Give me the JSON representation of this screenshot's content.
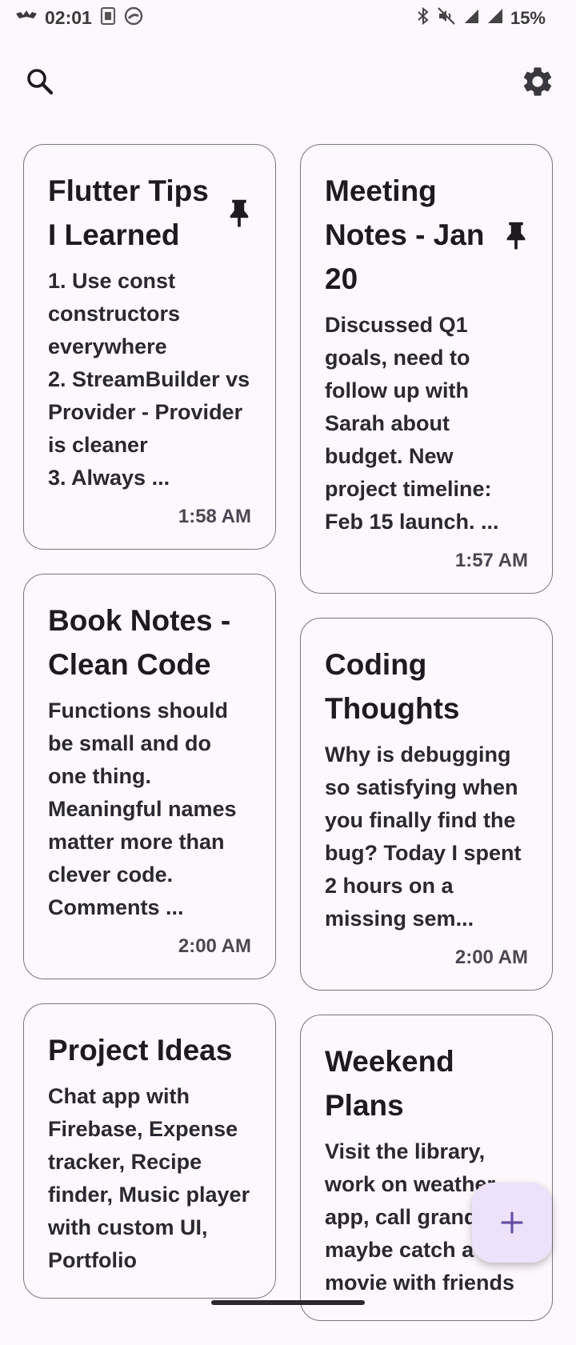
{
  "status_bar": {
    "time": "02:01",
    "battery": "15%",
    "icons": [
      "bat-icon",
      "notification-app-icon",
      "messenger-icon",
      "bluetooth-icon",
      "mute-icon",
      "signal-icon",
      "signal-icon-2"
    ]
  },
  "app_bar": {
    "search_icon": "search-icon",
    "settings_icon": "gear-icon"
  },
  "notes_left": [
    {
      "title": "Flutter Tips I Learned",
      "pinned": true,
      "body": "1. Use const constructors everywhere\n2. StreamBuilder vs Provider - Provider is cleaner\n3. Always ...",
      "time": "1:58 AM"
    },
    {
      "title": "Book Notes - Clean Code",
      "pinned": false,
      "body": "Functions should be small and do one thing. Meaningful names matter more than clever code. Comments ...",
      "time": "2:00 AM"
    },
    {
      "title": "Project Ideas",
      "pinned": false,
      "body": "Chat app with Firebase, Expense tracker, Recipe finder, Music player with custom UI, Portfolio",
      "time": ""
    }
  ],
  "notes_right": [
    {
      "title": "Meeting Notes - Jan 20",
      "pinned": true,
      "body": "Discussed Q1 goals, need to follow up with Sarah about budget. New project timeline: Feb 15 launch. ...",
      "time": "1:57 AM"
    },
    {
      "title": "Coding Thoughts",
      "pinned": false,
      "body": "Why is debugging so satisfying when you finally find the bug? Today I spent 2 hours on a missing sem...",
      "time": "2:00 AM"
    },
    {
      "title": "Weekend Plans",
      "pinned": false,
      "body": "Visit the library, work on weather app, call grandma, maybe catch a movie with friends",
      "time": ""
    }
  ],
  "fab": {
    "icon": "plus-icon"
  },
  "colors": {
    "background": "#fdf8fd",
    "card_border": "#7a7580",
    "fab_bg": "#ece3fb",
    "fab_icon": "#6750a4"
  }
}
